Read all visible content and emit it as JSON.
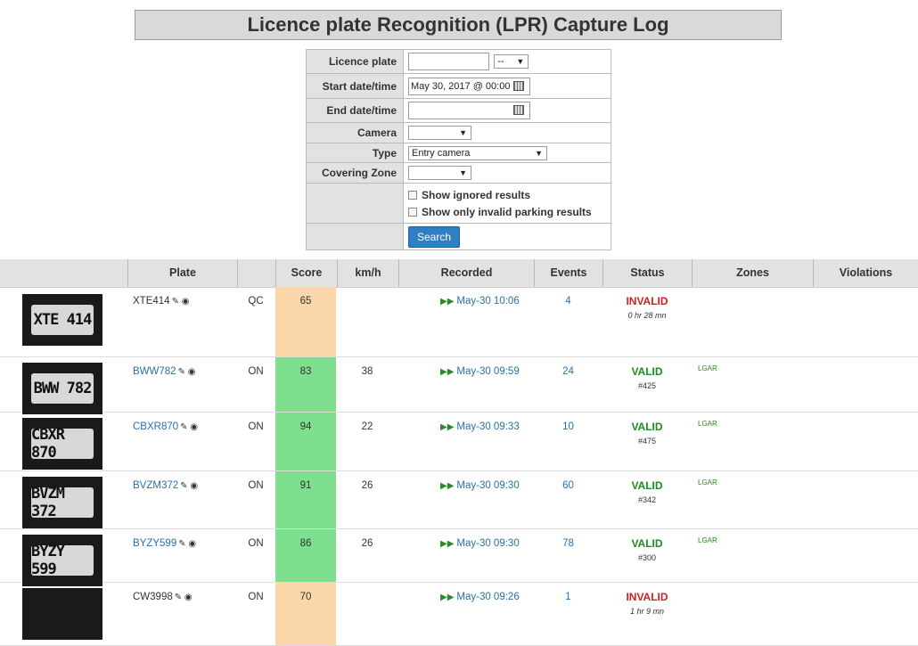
{
  "title": "Licence plate Recognition (LPR) Capture Log",
  "form": {
    "licence_plate_label": "Licence plate",
    "licence_plate_value": "",
    "plate_region_select": "--",
    "start_label": "Start date/time",
    "start_value": "May 30, 2017 @ 00:00",
    "end_label": "End date/time",
    "end_value": "",
    "camera_label": "Camera",
    "camera_value": "",
    "type_label": "Type",
    "type_value": "Entry camera",
    "zone_label": "Covering Zone",
    "zone_value": "",
    "show_ignored_label": "Show ignored results",
    "show_invalid_label": "Show only invalid parking results",
    "search_label": "Search"
  },
  "columns": {
    "plate": "Plate",
    "score": "Score",
    "kmh": "km/h",
    "recorded": "Recorded",
    "events": "Events",
    "status": "Status",
    "zones": "Zones",
    "violations": "Violations"
  },
  "colors": {
    "score_high": "#7ee08e",
    "score_low": "#fbd6a8",
    "valid": "#1f8a1f",
    "invalid": "#d02020",
    "link": "#2a6fa8",
    "button": "#2f7fc5"
  },
  "rows": [
    {
      "thumb": "XTE 414",
      "plate": "XTE414",
      "linked": false,
      "type": "QC",
      "score": "65",
      "score_level": "low",
      "kmh": "",
      "recorded": "May-30 10:06",
      "events": "4",
      "status": "INVALID",
      "status_sub": "0 hr 28 mn",
      "zone": ""
    },
    {
      "thumb": "BWW 782",
      "plate": "BWW782",
      "linked": true,
      "type": "ON",
      "score": "83",
      "score_level": "high",
      "kmh": "38",
      "recorded": "May-30 09:59",
      "events": "24",
      "status": "VALID",
      "status_sub": "#425",
      "zone": "LGAR"
    },
    {
      "thumb": "CBXR 870",
      "plate": "CBXR870",
      "linked": true,
      "type": "ON",
      "score": "94",
      "score_level": "high",
      "kmh": "22",
      "recorded": "May-30 09:33",
      "events": "10",
      "status": "VALID",
      "status_sub": "#475",
      "zone": "LGAR"
    },
    {
      "thumb": "BVZM 372",
      "plate": "BVZM372",
      "linked": true,
      "type": "ON",
      "score": "91",
      "score_level": "high",
      "kmh": "26",
      "recorded": "May-30 09:30",
      "events": "60",
      "status": "VALID",
      "status_sub": "#342",
      "zone": "LGAR"
    },
    {
      "thumb": "BYZY 599",
      "plate": "BYZY599",
      "linked": true,
      "type": "ON",
      "score": "86",
      "score_level": "high",
      "kmh": "26",
      "recorded": "May-30 09:30",
      "events": "78",
      "status": "VALID",
      "status_sub": "#300",
      "zone": "LGAR"
    },
    {
      "thumb": "",
      "plate": "CW3998",
      "linked": false,
      "type": "ON",
      "score": "70",
      "score_level": "low",
      "kmh": "",
      "recorded": "May-30 09:26",
      "events": "1",
      "status": "INVALID",
      "status_sub": "1 hr 9 mn",
      "zone": ""
    }
  ]
}
